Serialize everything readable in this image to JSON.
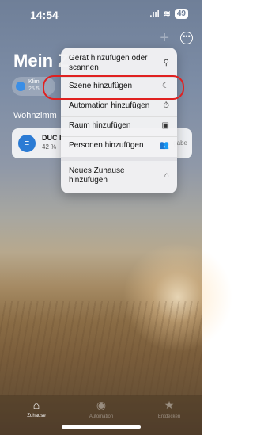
{
  "status": {
    "time": "14:54",
    "signal": ".ııl",
    "wifi": "≋",
    "battery": "49"
  },
  "header": {
    "title": "Mein Z"
  },
  "chip": {
    "label": "Klim",
    "value": "25.5"
  },
  "section": {
    "title": "Wohnzimm"
  },
  "device": {
    "name": "DUC I",
    "value": "42 %",
    "extra": "gabe"
  },
  "menu": {
    "items": [
      {
        "label": "Gerät hinzufügen oder scannen",
        "icon": "⚲"
      },
      {
        "label": "Szene hinzufügen",
        "icon": "☾"
      },
      {
        "label": "Automation hinzufügen",
        "icon": "⏱"
      },
      {
        "label": "Raum hinzufügen",
        "icon": "▣"
      },
      {
        "label": "Personen hinzufügen",
        "icon": "👥"
      },
      {
        "label": "Neues Zuhause hinzufügen",
        "icon": "⌂"
      }
    ]
  },
  "tabs": [
    {
      "label": "Zuhause",
      "icon": "⌂"
    },
    {
      "label": "Automation",
      "icon": "◉"
    },
    {
      "label": "Entdecken",
      "icon": "★"
    }
  ]
}
